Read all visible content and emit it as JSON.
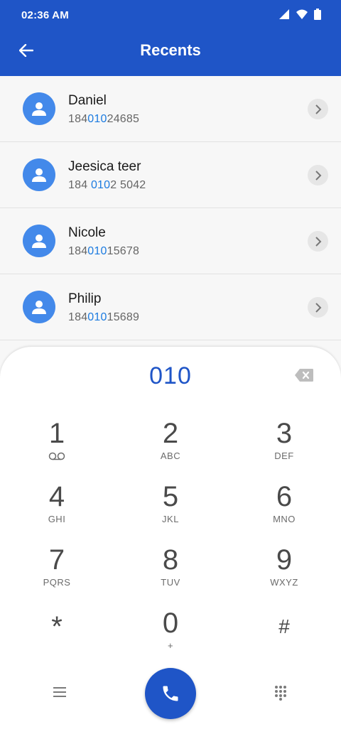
{
  "status_bar": {
    "time": "02:36 AM"
  },
  "header": {
    "title": "Recents"
  },
  "contacts": [
    {
      "name": "Daniel",
      "number_pre": "184",
      "number_hl": "010",
      "number_post": "24685"
    },
    {
      "name": "Jeesica teer",
      "number_pre": "184 ",
      "number_hl": "010",
      "number_post": "2 5042"
    },
    {
      "name": "Nicole",
      "number_pre": "184",
      "number_hl": "010",
      "number_post": "15678"
    },
    {
      "name": "Philip",
      "number_pre": "184",
      "number_hl": "010",
      "number_post": "15689"
    }
  ],
  "dialpad": {
    "dialed": "010",
    "keys": [
      {
        "digit": "1",
        "sub": ""
      },
      {
        "digit": "2",
        "sub": "ABC"
      },
      {
        "digit": "3",
        "sub": "DEF"
      },
      {
        "digit": "4",
        "sub": "GHI"
      },
      {
        "digit": "5",
        "sub": "JKL"
      },
      {
        "digit": "6",
        "sub": "MNO"
      },
      {
        "digit": "7",
        "sub": "PQRS"
      },
      {
        "digit": "8",
        "sub": "TUV"
      },
      {
        "digit": "9",
        "sub": "WXYZ"
      },
      {
        "digit": "*",
        "sub": ""
      },
      {
        "digit": "0",
        "sub": "+"
      },
      {
        "digit": "#",
        "sub": ""
      }
    ]
  },
  "colors": {
    "header_bg": "#1f55c7",
    "avatar": "#4389ea",
    "highlight": "#1c7be0"
  }
}
